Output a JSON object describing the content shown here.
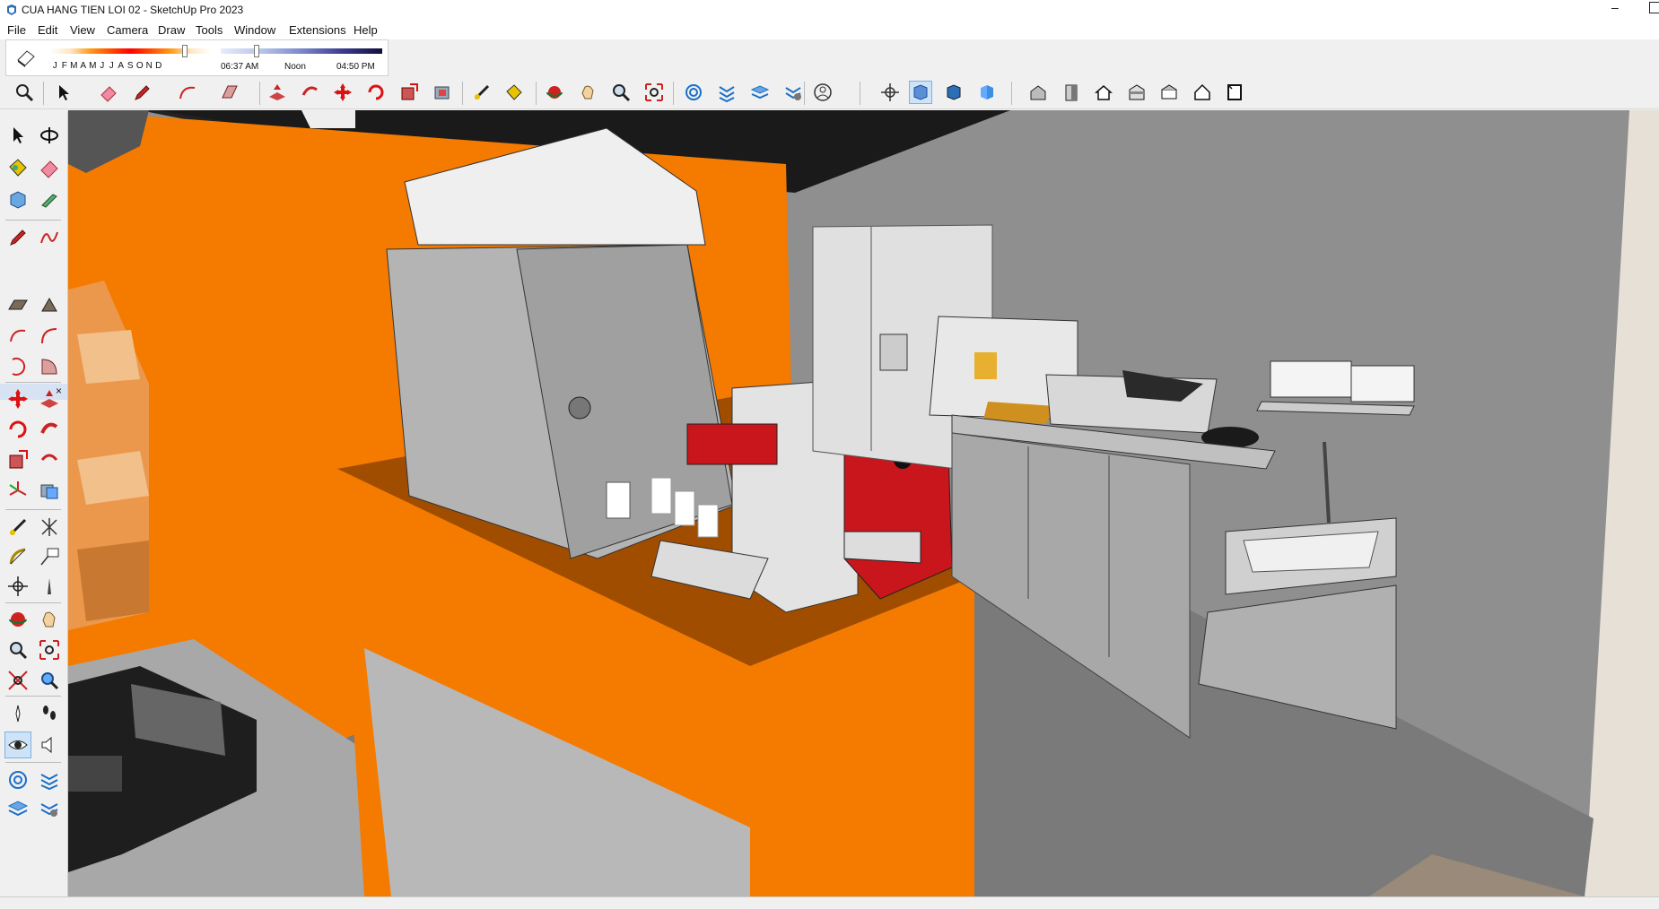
{
  "window": {
    "title": "CUA HANG TIEN LOI 02 - SketchUp Pro 2023",
    "minimize_glyph": "–"
  },
  "menu": [
    "File",
    "Edit",
    "View",
    "Camera",
    "Draw",
    "Tools",
    "Window",
    "Extensions",
    "Help"
  ],
  "shadows": {
    "months": [
      "J",
      "F",
      "M",
      "A",
      "M",
      "J",
      "J",
      "A",
      "S",
      "O",
      "N",
      "D"
    ],
    "time_start": "06:37 AM",
    "time_mid": "Noon",
    "time_end": "04:50 PM",
    "month_fraction": 0.84,
    "time_fraction": 0.22
  },
  "main_toolbar_icons": [
    "zoom-extents-icon",
    "select-icon",
    "eraser-icon",
    "pencil-icon",
    "arc-icon",
    "rectangle-icon",
    "push-pull-icon",
    "follow-me-icon",
    "move-icon",
    "rotate-icon",
    "scale-icon",
    "offset-icon",
    "tape-measure-icon",
    "paint-bucket-icon",
    "orbit-icon",
    "pan-icon",
    "zoom-icon",
    "zoom-window-icon",
    "sandbox-icon",
    "outliner-icon",
    "layers-icon",
    "components-icon",
    "account-icon",
    "axes-icon",
    "standard-view-iso-icon",
    "front-view-icon",
    "right-view-icon",
    "iso-view-icon",
    "top-view-icon",
    "back-view-icon",
    "left-view-icon",
    "bottom-view-icon",
    "perspective-icon"
  ],
  "left_toolbar_icons": [
    "select-icon",
    "orbit-icon",
    "paint-bucket-icon",
    "eraser-icon",
    "component-icon",
    "tape-measure-icon",
    "line-icon",
    "freehand-icon",
    "rectangle-icon",
    "rotated-rectangle-icon",
    "arc-icon",
    "two-point-arc-icon",
    "three-point-arc-icon",
    "pie-icon",
    "move-icon",
    "push-pull-icon",
    "rotate-icon",
    "follow-me-icon",
    "scale-icon",
    "offset-icon",
    "axes-icon",
    "section-plane-icon",
    "dimension-icon",
    "text-icon",
    "protractor-icon",
    "label-icon",
    "position-camera-icon",
    "walk-icon",
    "look-around-icon",
    "zoom-icon",
    "zoom-window-icon",
    "zoom-extents-icon",
    "previous-view-icon",
    "sandbox-icon",
    "outliner-icon",
    "layers-icon",
    "components-icon"
  ],
  "tray": {
    "close_glyph": "×"
  },
  "colors": {
    "orange": "#f57a00",
    "counter_top": "#a04d00",
    "wall_gray": "#8f8f8f",
    "ceiling": "#1e1e1e",
    "machine_red": "#c8161c"
  }
}
